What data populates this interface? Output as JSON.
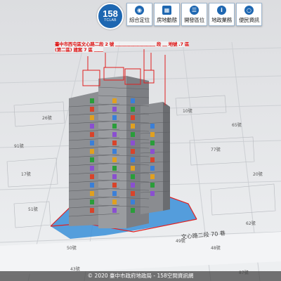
{
  "toolbar": {
    "logo_number": "158",
    "logo_sub": "TCLAB",
    "buttons": [
      {
        "label": "綜合定位",
        "icon": "location-pin-icon"
      },
      {
        "label": "房地動態",
        "icon": "building-icon"
      },
      {
        "label": "開發區位",
        "icon": "layers-icon"
      },
      {
        "label": "地政業務",
        "icon": "info-icon"
      },
      {
        "label": "便民資訊",
        "icon": "chat-icon"
      }
    ]
  },
  "callout": {
    "line1": "臺中市西屯區文心路二段 2 號 ﹏﹏﹏﹏﹏﹏﹏﹏﹏ 段 ﹏ 地號 .7 區",
    "line2": "(第二區) 建案 7 區 ﹏﹏"
  },
  "map_labels": {
    "road": "文心路二段 70 巷",
    "numbers": [
      "51號",
      "50號",
      "49號",
      "48號",
      "62號",
      "91號",
      "77號",
      "65號",
      "26號",
      "10號",
      "17號",
      "20號",
      "87號",
      "43號"
    ]
  },
  "footer": {
    "text": "© 2020 臺中市政府地政局 - 158空間資訊網"
  },
  "colors": {
    "brand": "#1e67b1",
    "callout": "#d11111",
    "highlight": "#e02020"
  }
}
